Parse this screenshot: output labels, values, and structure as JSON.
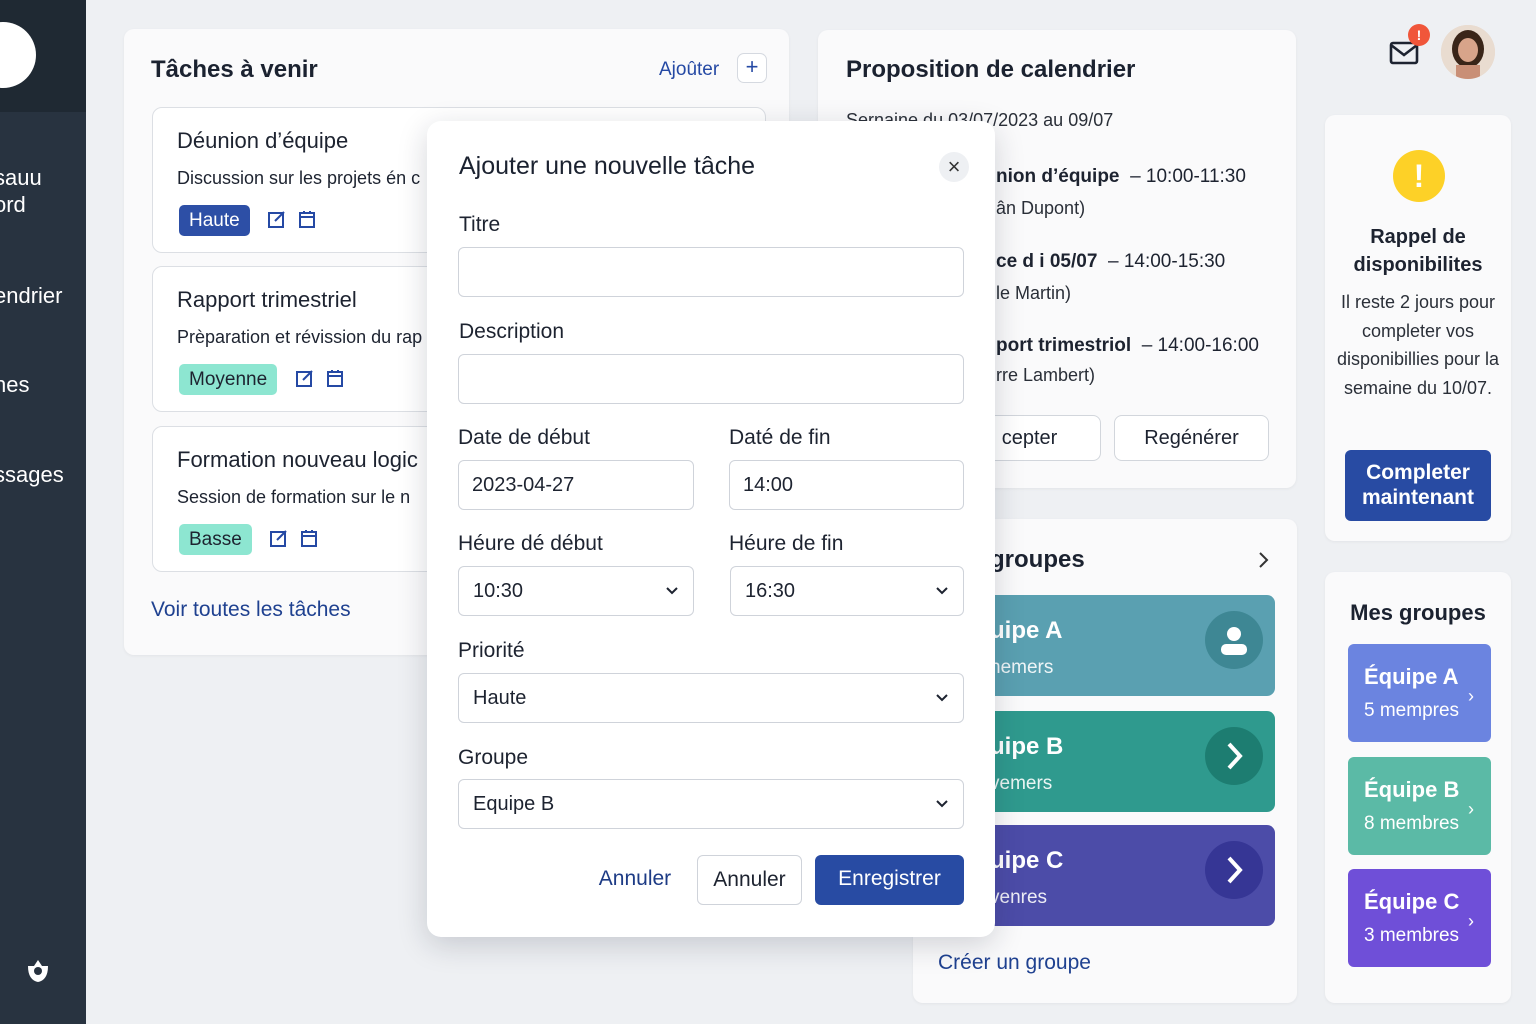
{
  "sidebar": {
    "items": [
      "sauu\nord",
      "endrier",
      "hes",
      "ssages"
    ]
  },
  "tasks": {
    "title": "Tâches à venir",
    "add_label": "Ajoûter",
    "add_icon": "+",
    "items": [
      {
        "title": "Déunion d’équipe",
        "desc": "Discussion sur les projets én c",
        "priority": "Haute"
      },
      {
        "title": "Rapport trimestriel",
        "desc": "Prèparation et révission du rap",
        "priority": "Moyenne"
      },
      {
        "title": "Formation nouveau logic",
        "desc": "Session de formation sur le n",
        "priority": "Basse"
      }
    ],
    "see_all": "Voir toutes les tâches"
  },
  "calendar": {
    "title": "Proposition de calendrier",
    "week": "Sernaine du 03/07/2023 au 09/07",
    "events": [
      {
        "name": "nion d’équipe",
        "time": "– 10:00-11:30",
        "person": "ân Dupont)"
      },
      {
        "name": "ce d i 05/07",
        "time": "– 14:00-15:30",
        "person": "le Martin)"
      },
      {
        "name": "port trimestriol",
        "time": "– 14:00-16:00",
        "person": "rre Lambert)"
      }
    ],
    "accept_label": "cepter",
    "regen_label": "Regénérer"
  },
  "groups_mid": {
    "title": "groupes",
    "rows": [
      {
        "name": "uipe A",
        "sub": "nemers",
        "color": "#5aa0b1",
        "icon": "user-icon"
      },
      {
        "name": "uipe B",
        "sub": "vemers",
        "color": "#2f9a8e",
        "icon": "chevron-right-icon"
      },
      {
        "name": "uipe C",
        "sub": "venres",
        "color": "#4c4ca8",
        "icon": "chevron-right-icon"
      }
    ],
    "create": "Créer un groupe"
  },
  "header": {
    "notif_count": "!",
    "mail_icon": "mail-icon",
    "avatar_icon": "avatar"
  },
  "reminder": {
    "icon": "!",
    "title": "Rappel de disponibilites",
    "text": "Il reste 2 jours pour completer vos disponibillies pour la semaine du 10/07.",
    "button": "Completer maintenant"
  },
  "my_groups": {
    "title": "Mes groupes",
    "items": [
      {
        "name": "Équipe A",
        "sub": "5 mempres",
        "color": "#6b84e0"
      },
      {
        "name": "Équipe B",
        "sub": "8 membres",
        "color": "#5bbaa6"
      },
      {
        "name": "Équipe C",
        "sub": "3 membres",
        "color": "#6f4fd8"
      }
    ]
  },
  "modal": {
    "title": "Ajouter une nouvelle tâche",
    "close": "×",
    "fields": {
      "title_label": "Titre",
      "title_value": "",
      "desc_label": "Description",
      "desc_value": "",
      "start_date_label": "Date de début",
      "start_date_value": "2023-04-27",
      "end_date_label": "Daté de fin",
      "end_date_value": "14:00",
      "start_time_label": "Héure dé début",
      "start_time_value": "10:30",
      "end_time_label": "Héure de fin",
      "end_time_value": "16:30",
      "priority_label": "Priorité",
      "priority_value": "Haute",
      "group_label": "Groupe",
      "group_value": "Equipe B"
    },
    "cancel_text": "Annuler",
    "cancel_outline": "Annuler",
    "save": "Enregistrer"
  }
}
